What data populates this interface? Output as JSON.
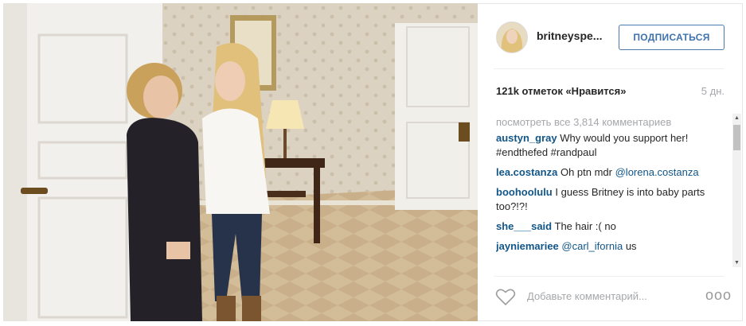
{
  "post": {
    "username": "britneyspe...",
    "follow_label": "ПОДПИСАТЬСЯ",
    "likes": "121k отметок «Нравится»",
    "time": "5 дн.",
    "view_all": "посмотреть все 3,814 комментариев",
    "comments": [
      {
        "user": "austyn_gray",
        "text": "Why would you support her! #endthefed #randpaul",
        "mention": ""
      },
      {
        "user": "lea.costanza",
        "text": "Oh ptn mdr",
        "mention": "@lorena.costanza"
      },
      {
        "user": "boohoolulu",
        "text": "I guess Britney is into baby parts too?!?!",
        "mention": ""
      },
      {
        "user": "she___said",
        "text": "The hair :( no",
        "mention": ""
      },
      {
        "user": "jayniemariee",
        "text": "us",
        "mention": "@carl_ifornia"
      }
    ],
    "add_comment_placeholder": "Добавьте комментарий...",
    "more_label": "ooo"
  },
  "icons": {
    "heart": "heart-icon",
    "more": "more-options-icon",
    "scroll_up": "scroll-up-icon",
    "scroll_down": "scroll-down-icon"
  },
  "colors": {
    "accent": "#3f72ad",
    "username": "#125688",
    "muted": "#a5a7aa"
  }
}
